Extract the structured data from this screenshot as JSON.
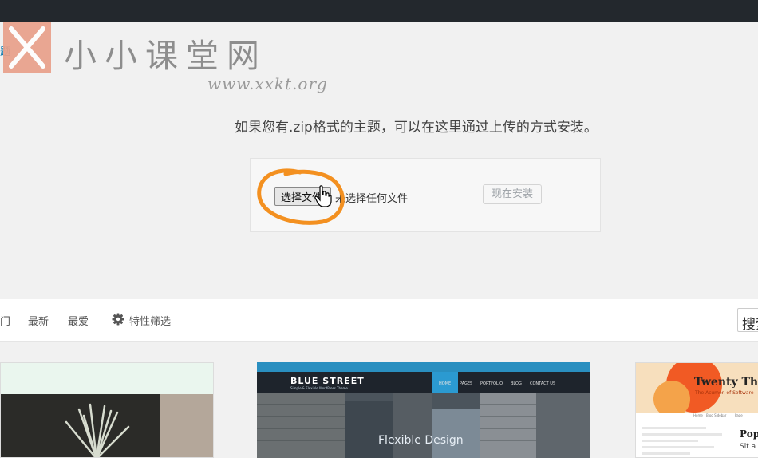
{
  "watermark": {
    "brand": "小小课堂网",
    "url": "www.xxkt.org"
  },
  "edge_tab": "题",
  "upload": {
    "description": "如果您有.zip格式的主题，可以在这里通过上传的方式安装。",
    "choose_file_label": "选择文件",
    "no_file_text": "未选择任何文件",
    "install_label": "现在安装"
  },
  "filters": {
    "items": [
      "门",
      "最新",
      "最爱"
    ],
    "feature_filter_label": "特性筛选",
    "search_placeholder": "搜索"
  },
  "themes": [
    {
      "brand": "BLUE STREET",
      "tagline": "Simple & Flexible WordPress Theme",
      "menu": [
        "HOME",
        "PAGES",
        "PORTFOLIO",
        "BLOG",
        "CONTACT US"
      ],
      "caption": "Flexible Design"
    },
    {
      "title": "Twenty Th",
      "tagline": "The Acumen of Software",
      "nav": [
        "Home",
        "Blog Sidebar",
        "Page"
      ],
      "section_title": "Popu",
      "small_text": "Sit a"
    }
  ],
  "colors": {
    "topbar": "#23282d",
    "accent_blue": "#2b9ad1",
    "annotation_orange": "#f39020"
  }
}
